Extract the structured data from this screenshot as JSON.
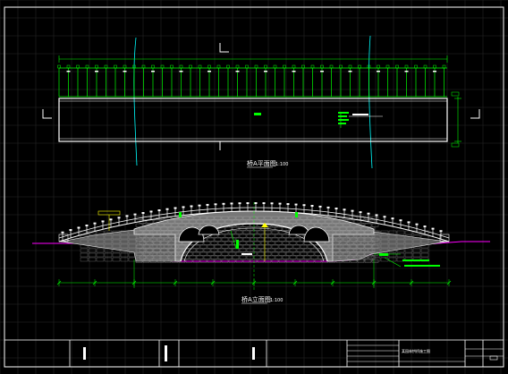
{
  "drawing": {
    "colors": {
      "background": "#000000",
      "grid": "#2b2b2b",
      "frame": "#ffffff",
      "green": "#00ff00",
      "cyan": "#00ffff",
      "magenta": "#ff00ff",
      "yellow": "#ffff00",
      "red": "#ff0000",
      "hatch": "#9a9a9a"
    },
    "plan_view": {
      "caption": "桥A平面图",
      "scale": "1:100"
    },
    "elevation_view": {
      "caption": "桥A立面图",
      "scale": "1:100"
    },
    "title_block": {
      "drawing_title": "某园林拱桥施工图"
    }
  }
}
